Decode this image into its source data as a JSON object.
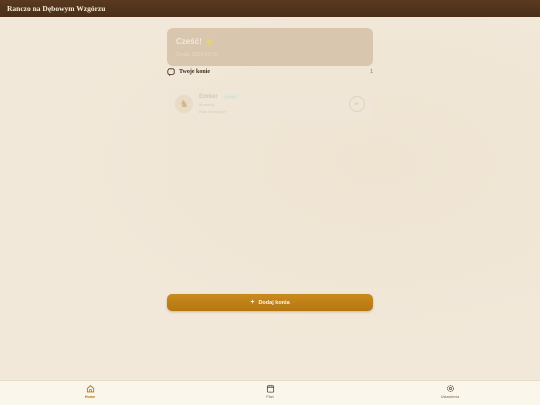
{
  "app": {
    "title": "Ranczo na Dębowym Wzgórzu"
  },
  "greeting": {
    "hello": "Cześć!",
    "date": "Środa, 2025-02-26"
  },
  "horses_section": {
    "label": "Twoje konie",
    "count": "1"
  },
  "horses": [
    {
      "name": "Ember",
      "badge": "gotowy",
      "breed": "Mustang",
      "status": "Brak treningów"
    }
  ],
  "add_button": {
    "label": "Dodaj konia"
  },
  "nav": {
    "items": [
      {
        "label": "Home",
        "icon": "home-icon",
        "active": true
      },
      {
        "label": "Plan",
        "icon": "calendar-icon",
        "active": false
      },
      {
        "label": "Ustawienia",
        "icon": "gear-icon",
        "active": false
      }
    ]
  },
  "colors": {
    "topbar": "#4a2e18",
    "accent": "#c98a1e",
    "background": "#f1e8d9"
  }
}
